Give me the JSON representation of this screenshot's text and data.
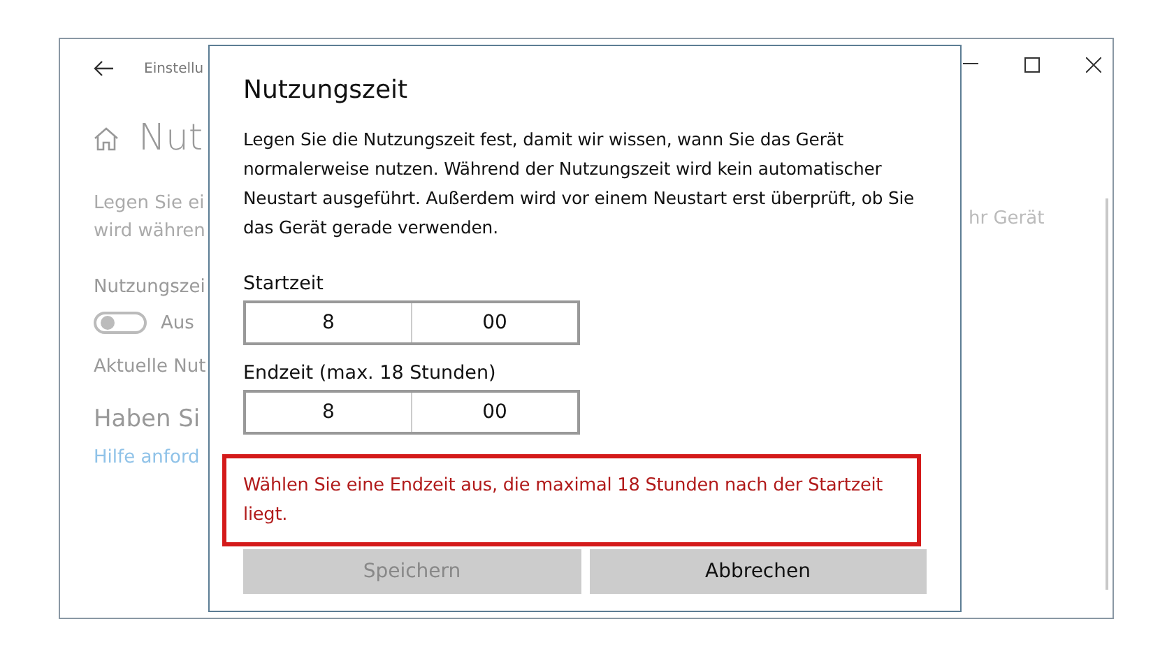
{
  "window": {
    "breadcrumb": "Einstellu",
    "heading": "Nut",
    "description_lines": [
      "Legen Sie ei",
      "wird währen"
    ],
    "description_right": "hr Gerät",
    "setting_label": "Nutzungszei",
    "toggle": {
      "on": false,
      "label": "Aus"
    },
    "current_label": "Aktuelle Nut",
    "section_heading": "Haben Si",
    "help_link": "Hilfe anford"
  },
  "dialog": {
    "title": "Nutzungszeit",
    "text": "Legen Sie die Nutzungszeit fest, damit wir wissen, wann Sie das Gerät normalerweise nutzen. Während der Nutzungszeit wird kein automatischer Neustart ausgeführt. Außerdem wird vor einem Neustart erst überprüft, ob Sie das Gerät gerade verwenden.",
    "fields": [
      {
        "label": "Startzeit",
        "hour": "8",
        "minute": "00"
      },
      {
        "label": "Endzeit (max. 18 Stunden)",
        "hour": "8",
        "minute": "00"
      }
    ],
    "error": "Wählen Sie eine Endzeit aus, die maximal 18 Stunden nach der Startzeit liegt.",
    "buttons": [
      {
        "label": "Speichern",
        "disabled": true
      },
      {
        "label": "Abbrechen",
        "disabled": false
      }
    ]
  }
}
